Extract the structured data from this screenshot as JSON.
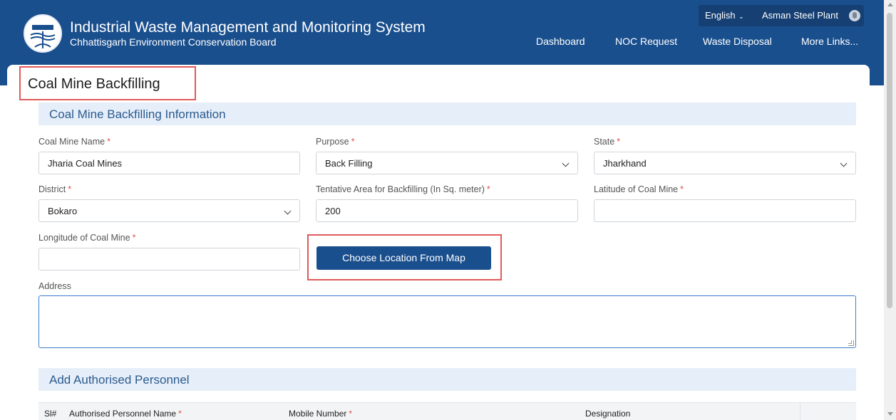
{
  "header": {
    "title": "Industrial Waste Management and Monitoring System",
    "subtitle": "Chhattisgarh Environment Conservation Board",
    "language": "English",
    "user": "Asman Steel Plant",
    "nav": [
      "Dashboard",
      "NOC Request",
      "Waste Disposal",
      "More Links..."
    ],
    "brand_color": "#1a4f8e"
  },
  "page": {
    "title": "Coal Mine Backfilling"
  },
  "sections": {
    "info_title": "Coal Mine Backfilling Information",
    "personnel_title": "Add Authorised Personnel"
  },
  "form": {
    "coal_mine_name": {
      "label": "Coal Mine Name",
      "value": "Jharia Coal Mines"
    },
    "purpose": {
      "label": "Purpose",
      "value": "Back Filling"
    },
    "state": {
      "label": "State",
      "value": "Jharkhand"
    },
    "district": {
      "label": "District",
      "value": "Bokaro"
    },
    "area": {
      "label": "Tentative Area for Backfilling (In Sq. meter)",
      "value": "200"
    },
    "latitude": {
      "label": "Latitude of Coal Mine",
      "value": ""
    },
    "longitude": {
      "label": "Longitude of Coal Mine",
      "value": ""
    },
    "map_button": "Choose Location From Map",
    "address": {
      "label": "Address",
      "value": ""
    },
    "required_mark": "*"
  },
  "table": {
    "columns": [
      "Sl#",
      "Authorised Personnel Name",
      "Mobile Number",
      "Designation"
    ]
  }
}
